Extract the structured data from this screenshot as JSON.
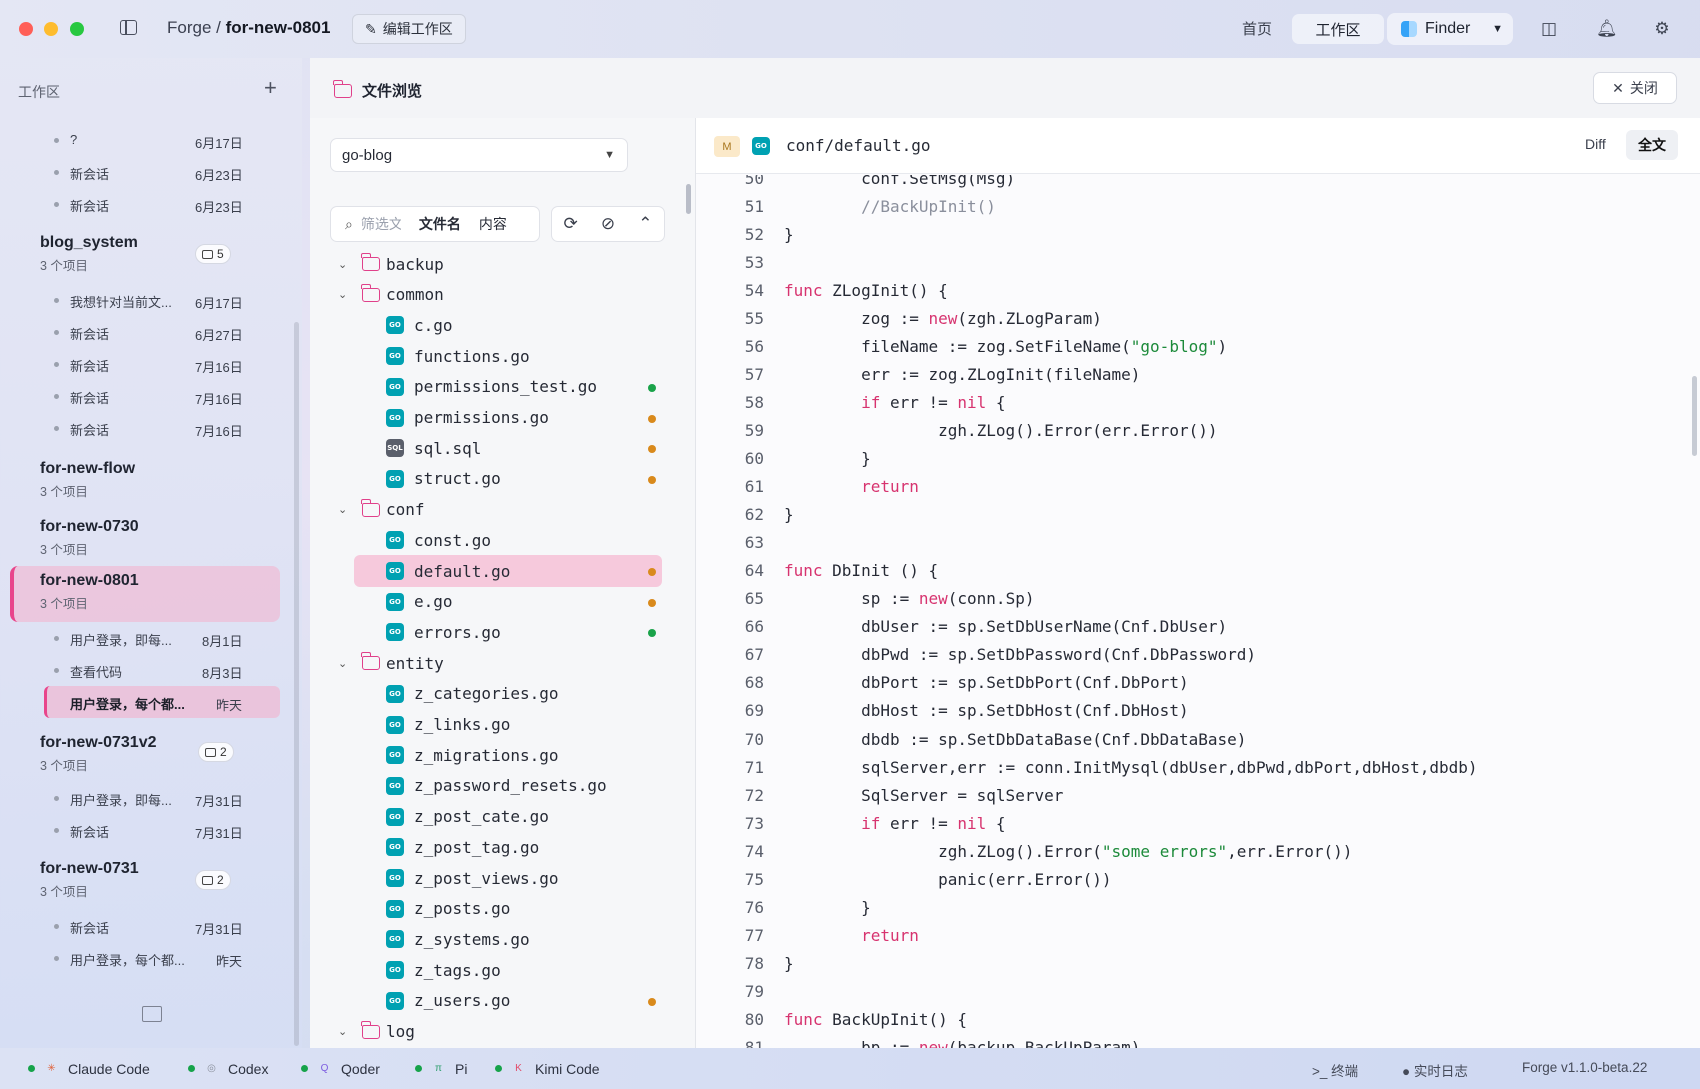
{
  "titlebar": {
    "crumb_workspace": "Forge",
    "crumb_sep": " / ",
    "crumb_project": "for-new-0801",
    "edit_workspace": "编辑工作区",
    "nav_home": "首页",
    "nav_workspace": "工作区",
    "finder_label": "Finder"
  },
  "sidebar": {
    "header": "工作区",
    "top_sessions": [
      {
        "title": "?",
        "date": "6月17日"
      },
      {
        "title": "新会话",
        "date": "6月23日"
      },
      {
        "title": "新会话",
        "date": "6月23日"
      }
    ],
    "projects": [
      {
        "name": "blog_system",
        "count": "3 个项目",
        "badge": "5",
        "sessions": [
          {
            "title": "我想针对当前文...",
            "date": "6月17日"
          },
          {
            "title": "新会话",
            "date": "6月27日"
          },
          {
            "title": "新会话",
            "date": "7月16日"
          },
          {
            "title": "新会话",
            "date": "7月16日"
          },
          {
            "title": "新会话",
            "date": "7月16日"
          }
        ]
      },
      {
        "name": "for-new-flow",
        "count": "3 个项目"
      },
      {
        "name": "for-new-0730",
        "count": "3 个项目"
      },
      {
        "name": "for-new-0801",
        "count": "3 个项目",
        "sessions": [
          {
            "title": "用户登录，即每...",
            "date": "8月1日"
          },
          {
            "title": "查看代码",
            "date": "8月3日"
          },
          {
            "title": "用户登录，每个都...",
            "date": "昨天"
          }
        ]
      },
      {
        "name": "for-new-0731v2",
        "count": "3 个项目",
        "badge": "2",
        "sessions": [
          {
            "title": "用户登录，即每...",
            "date": "7月31日"
          },
          {
            "title": "新会话",
            "date": "7月31日"
          }
        ]
      },
      {
        "name": "for-new-0731",
        "count": "3 个项目",
        "badge": "2",
        "sessions": [
          {
            "title": "新会话",
            "date": "7月31日"
          },
          {
            "title": "用户登录，每个都...",
            "date": "昨天"
          }
        ]
      }
    ]
  },
  "panel": {
    "title": "文件浏览",
    "close_label": "关闭",
    "repo": "go-blog",
    "filter_placeholder": "筛选文件",
    "tab_filename": "文件名",
    "tab_content": "内容",
    "tree": [
      {
        "type": "folder",
        "name": "backup"
      },
      {
        "type": "folder",
        "name": "common"
      },
      {
        "type": "file",
        "icon": "GO",
        "name": "c.go",
        "status": ""
      },
      {
        "type": "file",
        "icon": "GO",
        "name": "functions.go",
        "status": ""
      },
      {
        "type": "file",
        "icon": "GO",
        "name": "permissions_test.go",
        "status": "#1aa34a"
      },
      {
        "type": "file",
        "icon": "GO",
        "name": "permissions.go",
        "status": "#d98a1c"
      },
      {
        "type": "file",
        "icon": "SQL",
        "name": "sql.sql",
        "status": "#d98a1c"
      },
      {
        "type": "file",
        "icon": "GO",
        "name": "struct.go",
        "status": "#d98a1c"
      },
      {
        "type": "folder",
        "name": "conf"
      },
      {
        "type": "file",
        "icon": "GO",
        "name": "const.go",
        "status": ""
      },
      {
        "type": "file",
        "icon": "GO",
        "name": "default.go",
        "status": "#d98a1c",
        "selected": true
      },
      {
        "type": "file",
        "icon": "GO",
        "name": "e.go",
        "status": "#d98a1c"
      },
      {
        "type": "file",
        "icon": "GO",
        "name": "errors.go",
        "status": "#1aa34a"
      },
      {
        "type": "folder",
        "name": "entity"
      },
      {
        "type": "file",
        "icon": "GO",
        "name": "z_categories.go",
        "status": ""
      },
      {
        "type": "file",
        "icon": "GO",
        "name": "z_links.go",
        "status": ""
      },
      {
        "type": "file",
        "icon": "GO",
        "name": "z_migrations.go",
        "status": ""
      },
      {
        "type": "file",
        "icon": "GO",
        "name": "z_password_resets.go",
        "status": ""
      },
      {
        "type": "file",
        "icon": "GO",
        "name": "z_post_cate.go",
        "status": ""
      },
      {
        "type": "file",
        "icon": "GO",
        "name": "z_post_tag.go",
        "status": ""
      },
      {
        "type": "file",
        "icon": "GO",
        "name": "z_post_views.go",
        "status": ""
      },
      {
        "type": "file",
        "icon": "GO",
        "name": "z_posts.go",
        "status": ""
      },
      {
        "type": "file",
        "icon": "GO",
        "name": "z_systems.go",
        "status": ""
      },
      {
        "type": "file",
        "icon": "GO",
        "name": "z_tags.go",
        "status": ""
      },
      {
        "type": "file",
        "icon": "GO",
        "name": "z_users.go",
        "status": "#d98a1c"
      },
      {
        "type": "folder",
        "name": "log"
      }
    ]
  },
  "code": {
    "status_letter": "M",
    "file_icon": "GO",
    "path": "conf/default.go",
    "diff_label": "Diff",
    "full_label": "全文",
    "lines": [
      {
        "n": "50",
        "t": "        conf.SetMsg(Msg)"
      },
      {
        "n": "51",
        "t": "        //BackUpInit()"
      },
      {
        "n": "52",
        "t": "}"
      },
      {
        "n": "53",
        "t": ""
      },
      {
        "n": "54",
        "t": "func ZLogInit() {"
      },
      {
        "n": "55",
        "t": "        zog := new(zgh.ZLogParam)"
      },
      {
        "n": "56",
        "t": "        fileName := zog.SetFileName(\"go-blog\")"
      },
      {
        "n": "57",
        "t": "        err := zog.ZLogInit(fileName)"
      },
      {
        "n": "58",
        "t": "        if err != nil {"
      },
      {
        "n": "59",
        "t": "                zgh.ZLog().Error(err.Error())"
      },
      {
        "n": "60",
        "t": "        }"
      },
      {
        "n": "61",
        "t": "        return"
      },
      {
        "n": "62",
        "t": "}"
      },
      {
        "n": "63",
        "t": ""
      },
      {
        "n": "64",
        "t": "func DbInit () {"
      },
      {
        "n": "65",
        "t": "        sp := new(conn.Sp)"
      },
      {
        "n": "66",
        "t": "        dbUser := sp.SetDbUserName(Cnf.DbUser)"
      },
      {
        "n": "67",
        "t": "        dbPwd := sp.SetDbPassword(Cnf.DbPassword)"
      },
      {
        "n": "68",
        "t": "        dbPort := sp.SetDbPort(Cnf.DbPort)"
      },
      {
        "n": "69",
        "t": "        dbHost := sp.SetDbHost(Cnf.DbHost)"
      },
      {
        "n": "70",
        "t": "        dbdb := sp.SetDbDataBase(Cnf.DbDataBase)"
      },
      {
        "n": "71",
        "t": "        sqlServer,err := conn.InitMysql(dbUser,dbPwd,dbPort,dbHost,dbdb)"
      },
      {
        "n": "72",
        "t": "        SqlServer = sqlServer"
      },
      {
        "n": "73",
        "t": "        if err != nil {"
      },
      {
        "n": "74",
        "t": "                zgh.ZLog().Error(\"some errors\",err.Error())"
      },
      {
        "n": "75",
        "t": "                panic(err.Error())"
      },
      {
        "n": "76",
        "t": "        }"
      },
      {
        "n": "77",
        "t": "        return"
      },
      {
        "n": "78",
        "t": "}"
      },
      {
        "n": "79",
        "t": ""
      },
      {
        "n": "80",
        "t": "func BackUpInit() {"
      },
      {
        "n": "81",
        "t": "        bp := new(backup.BackUpParam)"
      }
    ]
  },
  "statusbar": {
    "agents": [
      {
        "name": "Claude Code",
        "icon": "✳",
        "color": "#e0623a"
      },
      {
        "name": "Codex",
        "icon": "◎",
        "color": "#8a8f9c"
      },
      {
        "name": "Qoder",
        "icon": "Q",
        "color": "#7c5ce0"
      },
      {
        "name": "Pi",
        "icon": "π",
        "color": "#2a9d6b"
      },
      {
        "name": "Kimi Code",
        "icon": "K",
        "color": "#e24b6a"
      }
    ],
    "terminal": "终端",
    "live_log": "实时日志",
    "version": "Forge v1.1.0-beta.22"
  }
}
